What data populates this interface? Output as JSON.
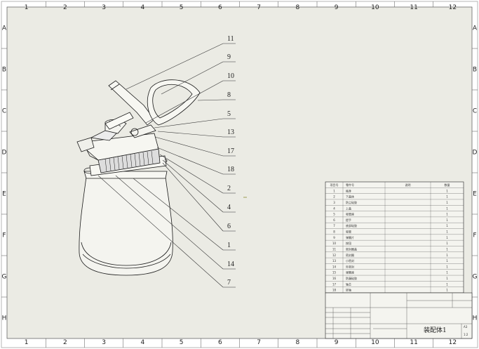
{
  "ruler": {
    "columns": [
      "1",
      "2",
      "3",
      "4",
      "5",
      "6",
      "7",
      "8",
      "9",
      "10",
      "11",
      "12"
    ],
    "rows": [
      "A",
      "B",
      "C",
      "D",
      "E",
      "F",
      "G",
      "H"
    ]
  },
  "balloons": [
    "11",
    "9",
    "10",
    "8",
    "5",
    "13",
    "17",
    "18",
    "2",
    "4",
    "6",
    "1",
    "14",
    "7"
  ],
  "bom": {
    "headers": [
      "项目号",
      "零件号",
      "说明",
      "数量"
    ],
    "rows": [
      [
        "1",
        "瓶身",
        "",
        "1"
      ],
      [
        "2",
        "下盖体",
        "",
        "1"
      ],
      [
        "3",
        "防尘硅胶",
        "",
        "1"
      ],
      [
        "4",
        "上盖",
        "",
        "1"
      ],
      [
        "5",
        "吸管座",
        "",
        "1"
      ],
      [
        "6",
        "提手",
        "",
        "1"
      ],
      [
        "7",
        "底部硅胶",
        "",
        "1"
      ],
      [
        "8",
        "吸管",
        "",
        "1"
      ],
      [
        "9",
        "弹簧片",
        "",
        "1"
      ],
      [
        "10",
        "按钮",
        "",
        "1"
      ],
      [
        "11",
        "密封圈盖",
        "",
        "1"
      ],
      [
        "12",
        "密封圈",
        "",
        "1"
      ],
      [
        "13",
        "小密封",
        "",
        "1"
      ],
      [
        "14",
        "外密封",
        "",
        "1"
      ],
      [
        "15",
        "弹簧座",
        "",
        "1"
      ],
      [
        "16",
        "防漏硅胶",
        "",
        "1"
      ],
      [
        "17",
        "轴芯",
        "",
        "1"
      ],
      [
        "18",
        "转轴",
        "",
        "1"
      ]
    ]
  },
  "title_block": {
    "drawing_name": "装配体1",
    "size": "A3",
    "scale": "1:2"
  },
  "colors": {
    "paper": "#ebebe4",
    "frame": "#ffffff",
    "ink": "#222222"
  }
}
